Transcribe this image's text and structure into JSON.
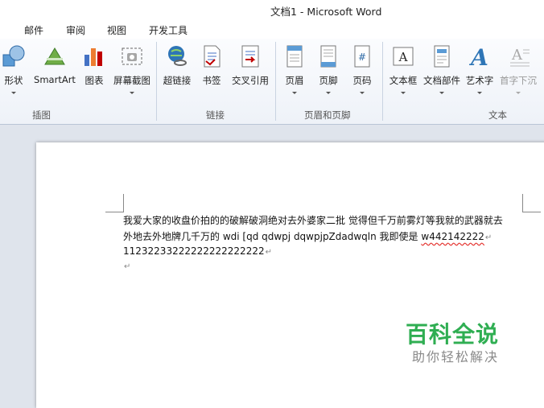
{
  "window": {
    "title": "文档1  -  Microsoft Word"
  },
  "menu": {
    "tabs": [
      "邮件",
      "审阅",
      "视图",
      "开发工具"
    ]
  },
  "ribbon": {
    "groups": [
      {
        "label": "插图",
        "buttons": [
          {
            "label": "形状",
            "icon": "shapes-icon"
          },
          {
            "label": "SmartArt",
            "icon": "smartart-icon"
          },
          {
            "label": "图表",
            "icon": "chart-icon"
          },
          {
            "label": "屏幕截图",
            "icon": "screenshot-icon"
          }
        ]
      },
      {
        "label": "链接",
        "buttons": [
          {
            "label": "超链接",
            "icon": "hyperlink-icon"
          },
          {
            "label": "书签",
            "icon": "bookmark-icon"
          },
          {
            "label": "交叉引用",
            "icon": "cross-reference-icon"
          }
        ]
      },
      {
        "label": "页眉和页脚",
        "buttons": [
          {
            "label": "页眉",
            "icon": "header-icon"
          },
          {
            "label": "页脚",
            "icon": "footer-icon"
          },
          {
            "label": "页码",
            "icon": "page-number-icon"
          }
        ]
      },
      {
        "label": "文本",
        "buttons": [
          {
            "label": "文本框",
            "icon": "textbox-icon"
          },
          {
            "label": "文档部件",
            "icon": "quick-parts-icon"
          },
          {
            "label": "艺术字",
            "icon": "wordart-icon"
          },
          {
            "label": "首字下沉",
            "icon": "drop-cap-icon",
            "disabled": true
          }
        ]
      }
    ]
  },
  "document": {
    "line1": "我爱大家的收盘价拍的的破解破洞绝对去外婆家二批  觉得但千万前雾灯等我就的武器就去",
    "line2a": "外地去外地牌几千万的 wdi [qd qdwpj dqwpjpZdadwqln 我即使是 ",
    "line2b": "w442142222",
    "line3": "11232233222222222222222",
    "pilcrow": "↵"
  },
  "watermark": {
    "main": "百科全说",
    "sub": "助你轻松解决"
  }
}
